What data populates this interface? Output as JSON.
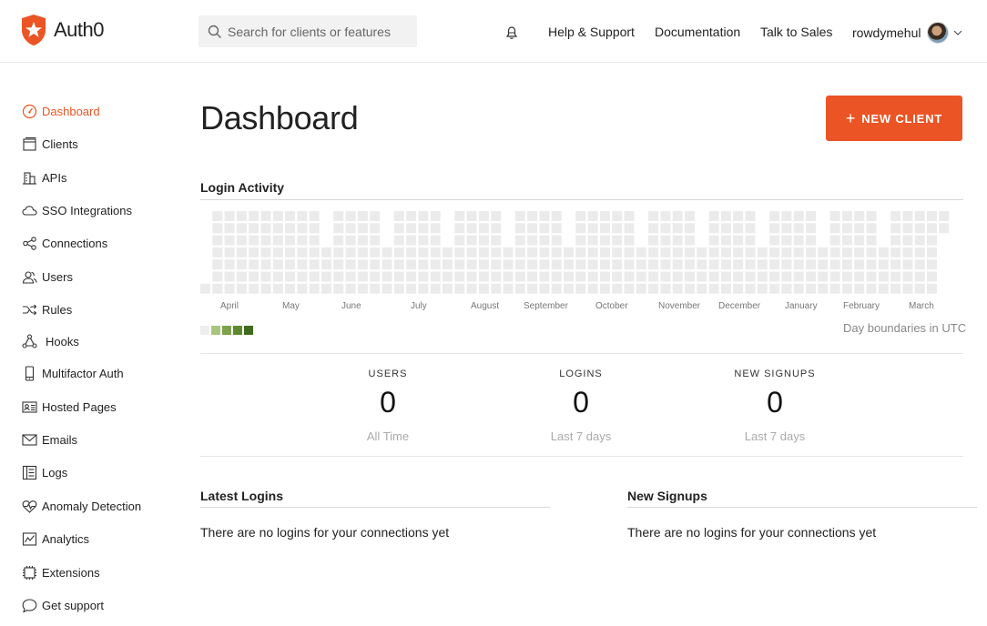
{
  "header": {
    "logo_text": "Auth0",
    "search_placeholder": "Search for clients or features",
    "links": [
      "Help & Support",
      "Documentation",
      "Talk to Sales"
    ],
    "user_name": "rowdymehul"
  },
  "sidebar": {
    "items": [
      {
        "label": "Dashboard",
        "icon": "speedometer-icon",
        "active": true
      },
      {
        "label": "Clients",
        "icon": "window-icon"
      },
      {
        "label": "APIs",
        "icon": "building-icon"
      },
      {
        "label": "SSO Integrations",
        "icon": "cloud-icon"
      },
      {
        "label": "Connections",
        "icon": "connections-icon"
      },
      {
        "label": "Users",
        "icon": "users-icon"
      },
      {
        "label": "Rules",
        "icon": "shuffle-icon"
      },
      {
        "label": "Hooks",
        "icon": "hooks-icon"
      },
      {
        "label": "Multifactor Auth",
        "icon": "phone-icon"
      },
      {
        "label": "Hosted Pages",
        "icon": "id-card-icon"
      },
      {
        "label": "Emails",
        "icon": "envelope-icon"
      },
      {
        "label": "Logs",
        "icon": "list-icon"
      },
      {
        "label": "Anomaly Detection",
        "icon": "heart-pulse-icon"
      },
      {
        "label": "Analytics",
        "icon": "chart-icon"
      },
      {
        "label": "Extensions",
        "icon": "chip-icon"
      },
      {
        "label": "Get support",
        "icon": "chat-bubble-icon"
      }
    ]
  },
  "main": {
    "title": "Dashboard",
    "new_client_label": "NEW CLIENT",
    "login_activity_title": "Login Activity",
    "months": [
      "April",
      "May",
      "June",
      "July",
      "August",
      "September",
      "October",
      "November",
      "December",
      "January",
      "February",
      "March"
    ],
    "legend_colors": [
      "#eeeeee",
      "#a7c67d",
      "#7ea24a",
      "#5e8a2e",
      "#3f6b1c"
    ],
    "heatmap_empty_color": "#ebebeb",
    "utc_note": "Day boundaries in UTC",
    "stats": [
      {
        "label": "USERS",
        "value": "0",
        "sub": "All Time"
      },
      {
        "label": "LOGINS",
        "value": "0",
        "sub": "Last 7 days"
      },
      {
        "label": "NEW SIGNUPS",
        "value": "0",
        "sub": "Last 7 days"
      }
    ],
    "latest_logins": {
      "title": "Latest Logins",
      "empty": "There are no logins for your connections yet"
    },
    "new_signups": {
      "title": "New Signups",
      "empty": "There are no logins for your connections yet"
    }
  },
  "colors": {
    "accent": "#eb5424"
  }
}
